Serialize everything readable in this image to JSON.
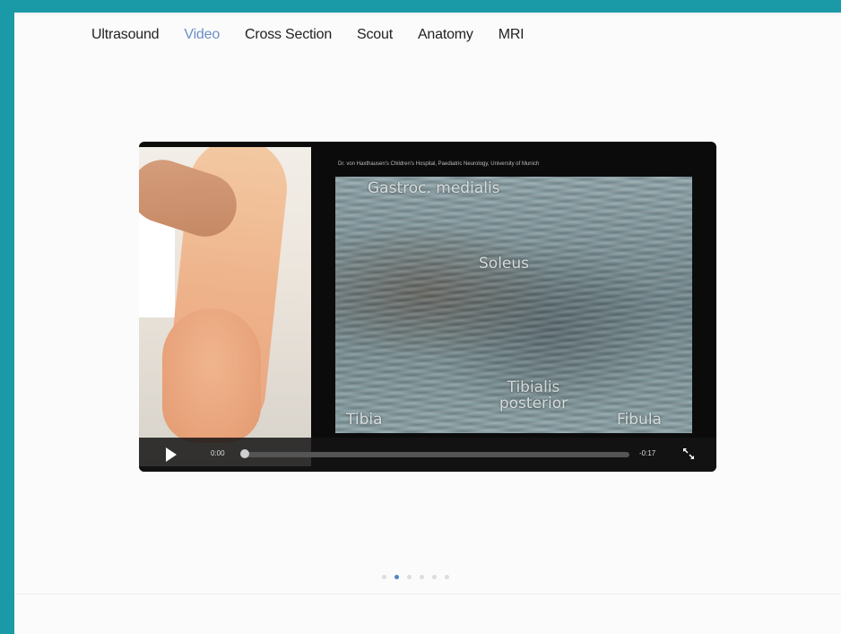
{
  "nav": {
    "tabs": [
      {
        "label": "Ultrasound",
        "active": false
      },
      {
        "label": "Video",
        "active": true
      },
      {
        "label": "Cross Section",
        "active": false
      },
      {
        "label": "Scout",
        "active": false
      },
      {
        "label": "Anatomy",
        "active": false
      },
      {
        "label": "MRI",
        "active": false
      }
    ]
  },
  "video": {
    "overlay_caption": "Dr. von Haxthausen's Children's Hospital, Paediatric Neurology, University of Munich",
    "labels": {
      "top": "Gastroc. medialis",
      "middle": "Soleus",
      "bottom_left": "Tibia",
      "bottom_center": "Tibialis posterior",
      "bottom_right": "Fibula"
    },
    "current_time": "0:00",
    "remaining_time": "-0:17",
    "progress": 0
  },
  "pagination": {
    "count": 6,
    "active_index": 1
  },
  "colors": {
    "frame": "#1a9aa6",
    "active_tab": "#6a8fc7",
    "active_dot": "#4a87c7"
  },
  "icons": {
    "play": "play-icon",
    "fullscreen": "fullscreen-icon"
  }
}
